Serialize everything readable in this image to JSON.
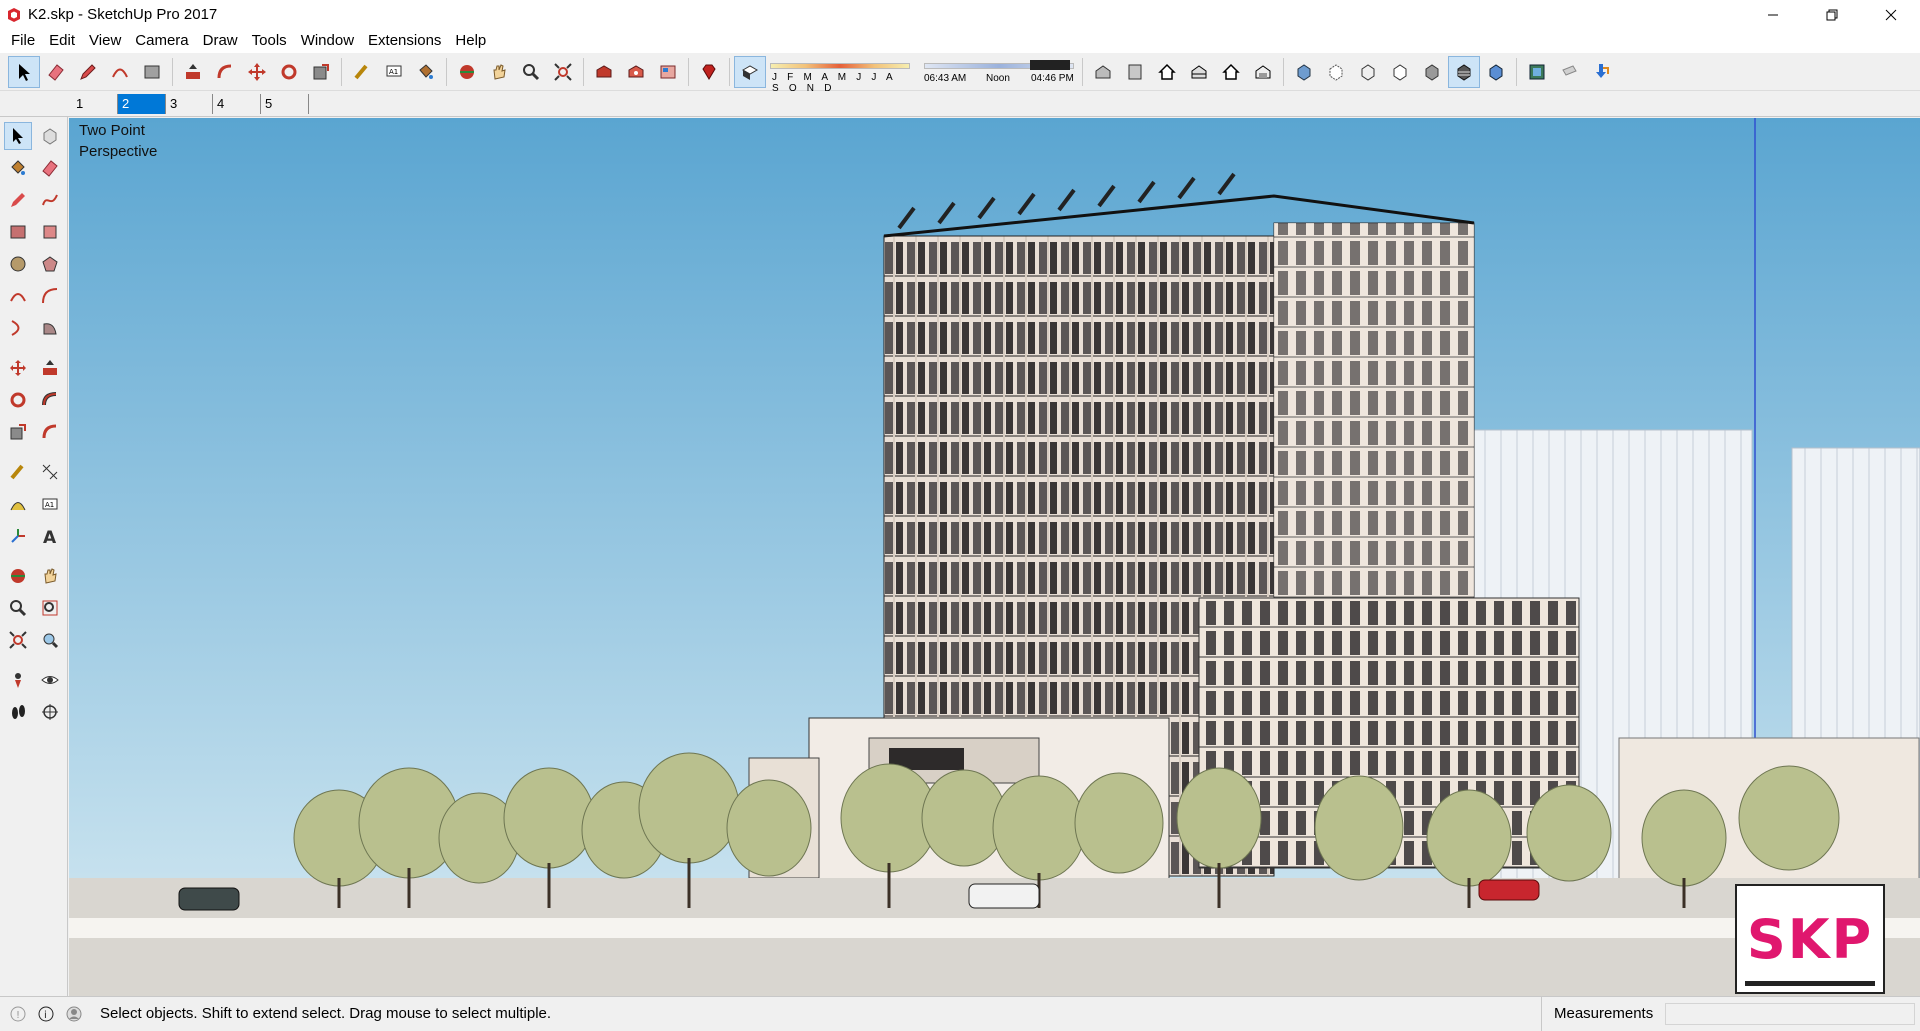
{
  "window": {
    "title": "K2.skp - SketchUp Pro 2017",
    "controls": {
      "minimize": "—",
      "restore": "❐",
      "close": "✕"
    }
  },
  "menu": [
    "File",
    "Edit",
    "View",
    "Camera",
    "Draw",
    "Tools",
    "Window",
    "Extensions",
    "Help"
  ],
  "toolbar": {
    "shadow_months": "J F M A M J J A S O N D",
    "time_start": "06:43 AM",
    "time_mid": "Noon",
    "time_end": "04:46 PM"
  },
  "scene_tabs": [
    "1",
    "2",
    "3",
    "4",
    "5"
  ],
  "active_scene_index": 1,
  "viewport": {
    "camera_label_line1": "Two Point",
    "camera_label_line2": "Perspective",
    "sky_top_color": "#5aa5d1",
    "sky_bottom_color": "#c6e1ee",
    "logo_text": "SKP",
    "logo_color": "#e0176e"
  },
  "status": {
    "message": "Select objects. Shift to extend select. Drag mouse to select multiple.",
    "measurements_label": "Measurements",
    "measurements_value": ""
  }
}
